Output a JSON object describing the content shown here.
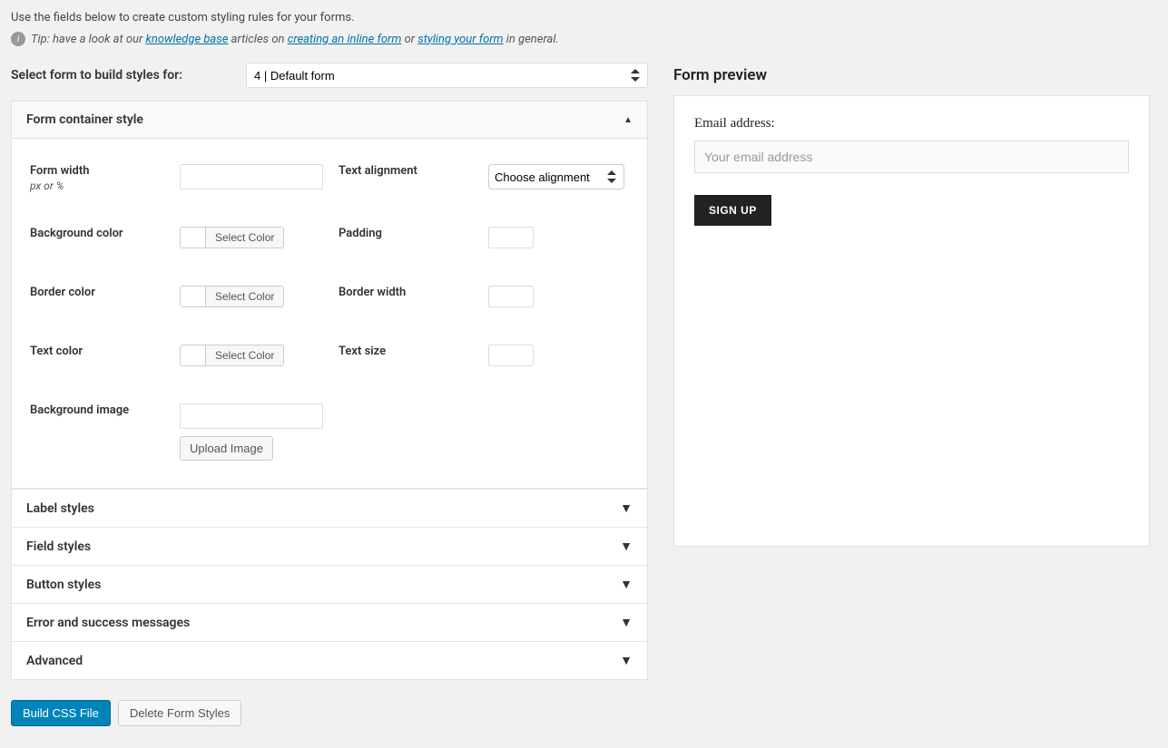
{
  "intro": "Use the fields below to create custom styling rules for your forms.",
  "tip": {
    "prefix": "Tip: have a look at our ",
    "kb_link": "knowledge base",
    "mid1": " articles on ",
    "inline_link": "creating an inline form",
    "mid2": " or ",
    "style_link": "styling your form",
    "suffix": " in general."
  },
  "select_form_label": "Select form to build styles for:",
  "select_form_value": "4 | Default form",
  "sections": {
    "container": {
      "title": "Form container style",
      "form_width_label": "Form width",
      "form_width_hint": "px or %",
      "text_alignment_label": "Text alignment",
      "alignment_placeholder": "Choose alignment",
      "background_color_label": "Background color",
      "padding_label": "Padding",
      "border_color_label": "Border color",
      "border_width_label": "Border width",
      "text_color_label": "Text color",
      "text_size_label": "Text size",
      "background_image_label": "Background image",
      "upload_btn": "Upload Image",
      "select_color": "Select Color"
    },
    "collapsed": [
      {
        "title": "Label styles"
      },
      {
        "title": "Field styles"
      },
      {
        "title": "Button styles"
      },
      {
        "title": "Error and success messages"
      },
      {
        "title": "Advanced"
      }
    ]
  },
  "actions": {
    "build": "Build CSS File",
    "delete": "Delete Form Styles"
  },
  "preview": {
    "title": "Form preview",
    "email_label": "Email address:",
    "email_placeholder": "Your email address",
    "signup": "SIGN UP"
  }
}
